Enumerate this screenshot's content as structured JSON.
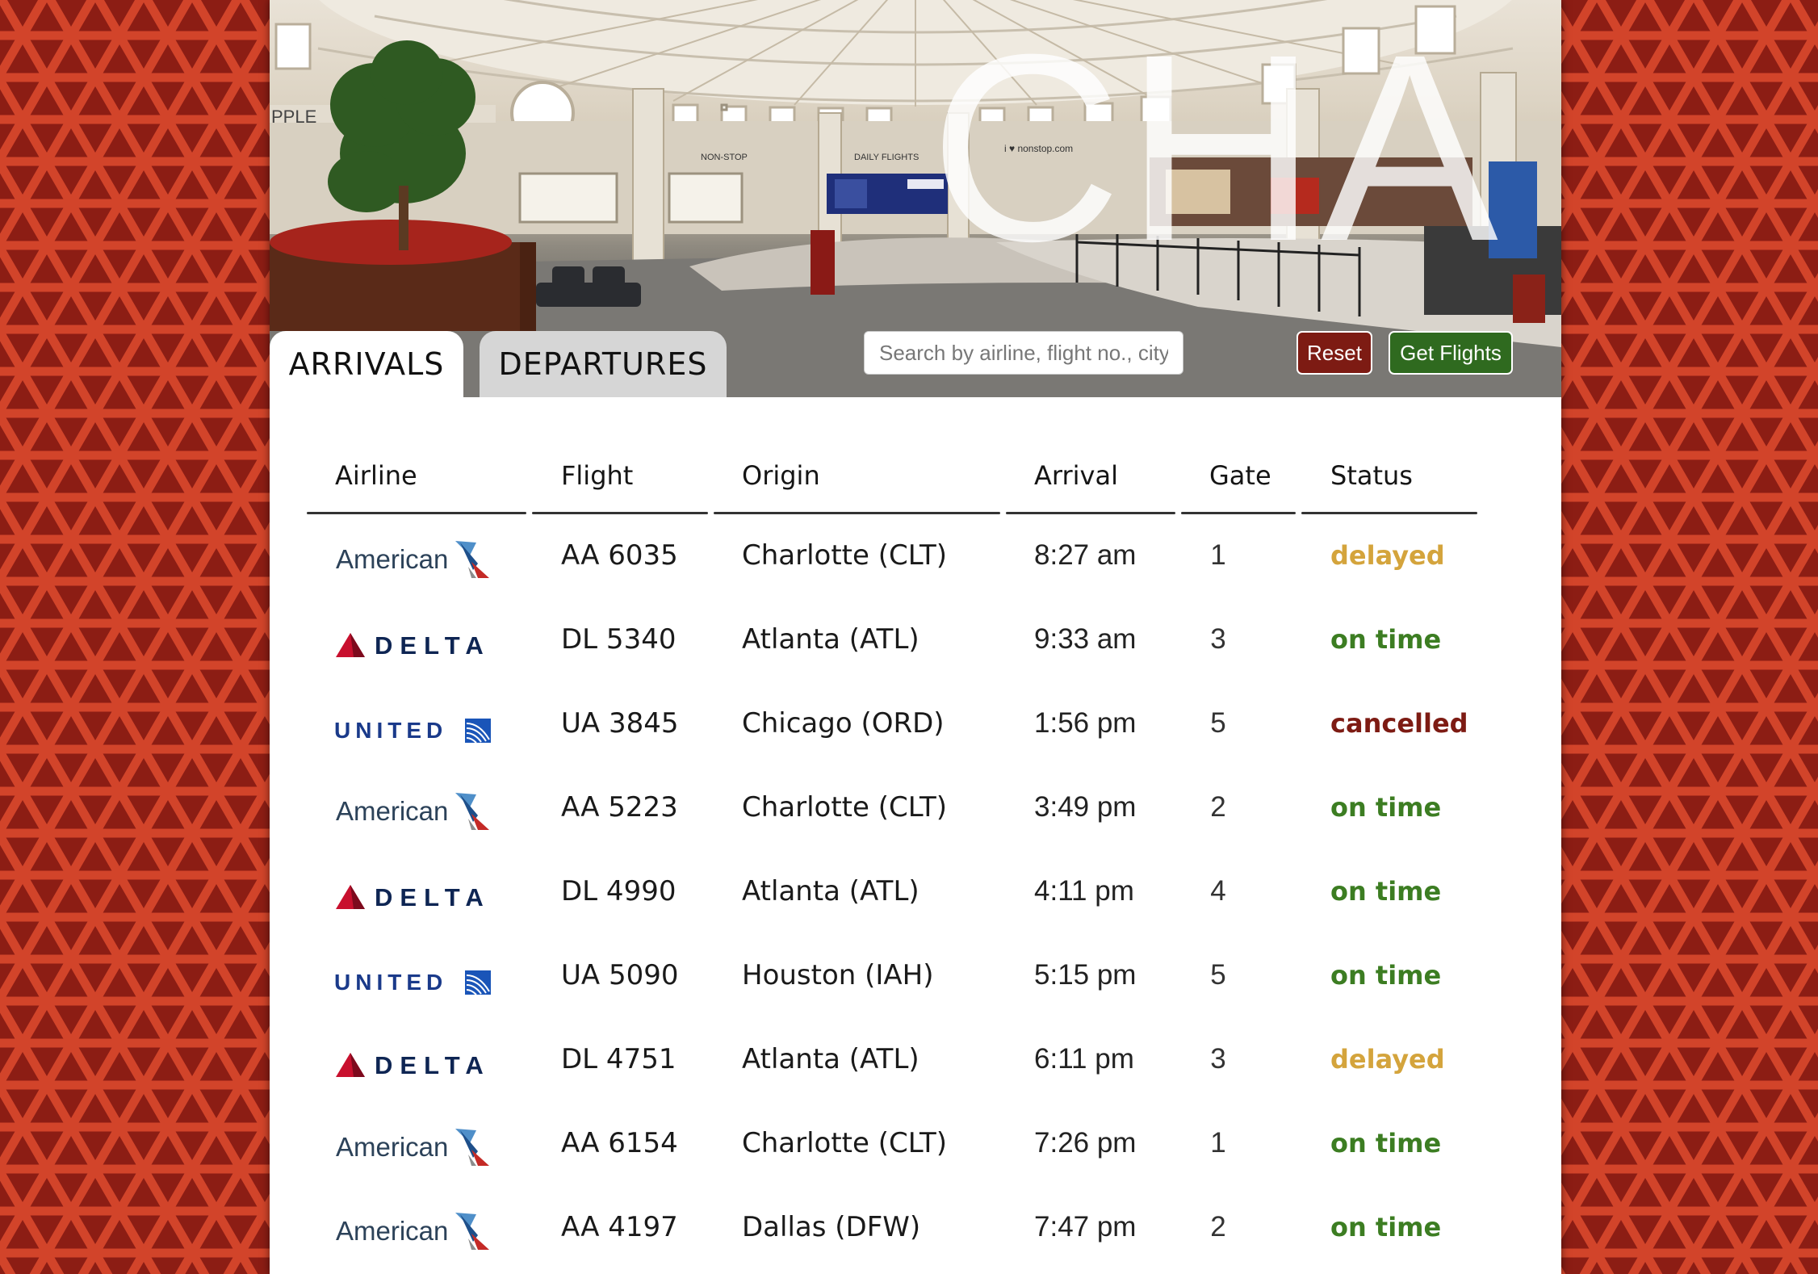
{
  "airport_code": "CHA",
  "hero": {
    "signs": [
      "PPLE",
      "NON-STOP",
      "DAILY FLIGHTS",
      "i ♥ nonstop.com"
    ]
  },
  "tabs": [
    {
      "label": "ARRIVALS",
      "active": true
    },
    {
      "label": "DEPARTURES",
      "active": false
    }
  ],
  "search": {
    "placeholder": "Search by airline, flight no., city, or status",
    "value": ""
  },
  "buttons": {
    "reset": "Reset",
    "get_flights": "Get Flights"
  },
  "colors": {
    "background": "#8c1d14",
    "pattern": "#d2442a",
    "reset_button": "#7d1b13",
    "get_flights_button": "#2f6a1f",
    "status_delayed": "#d4a43c",
    "status_on_time": "#3c7d22",
    "status_cancelled": "#7d1b13"
  },
  "table": {
    "headers": {
      "airline": "Airline",
      "flight": "Flight",
      "origin": "Origin",
      "arrival": "Arrival",
      "gate": "Gate",
      "status": "Status"
    },
    "rows": [
      {
        "airline": "American",
        "flight": "AA 6035",
        "origin": "Charlotte (CLT)",
        "arrival": "8:27 am",
        "gate": "1",
        "status": "delayed"
      },
      {
        "airline": "DELTA",
        "flight": "DL 5340",
        "origin": "Atlanta (ATL)",
        "arrival": "9:33 am",
        "gate": "3",
        "status": "on time"
      },
      {
        "airline": "UNITED",
        "flight": "UA 3845",
        "origin": "Chicago (ORD)",
        "arrival": "1:56 pm",
        "gate": "5",
        "status": "cancelled"
      },
      {
        "airline": "American",
        "flight": "AA 5223",
        "origin": "Charlotte (CLT)",
        "arrival": "3:49 pm",
        "gate": "2",
        "status": "on time"
      },
      {
        "airline": "DELTA",
        "flight": "DL 4990",
        "origin": "Atlanta (ATL)",
        "arrival": "4:11 pm",
        "gate": "4",
        "status": "on time"
      },
      {
        "airline": "UNITED",
        "flight": "UA 5090",
        "origin": "Houston (IAH)",
        "arrival": "5:15 pm",
        "gate": "5",
        "status": "on time"
      },
      {
        "airline": "DELTA",
        "flight": "DL 4751",
        "origin": "Atlanta (ATL)",
        "arrival": "6:11 pm",
        "gate": "3",
        "status": "delayed"
      },
      {
        "airline": "American",
        "flight": "AA 6154",
        "origin": "Charlotte (CLT)",
        "arrival": "7:26 pm",
        "gate": "1",
        "status": "on time"
      },
      {
        "airline": "American",
        "flight": "AA 4197",
        "origin": "Dallas (DFW)",
        "arrival": "7:47 pm",
        "gate": "2",
        "status": "on time"
      }
    ]
  }
}
